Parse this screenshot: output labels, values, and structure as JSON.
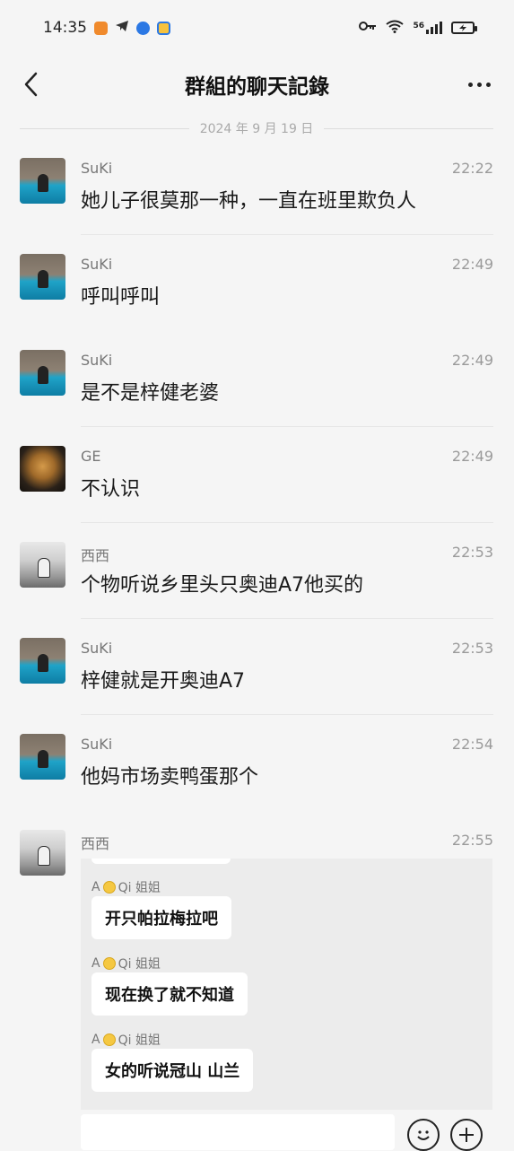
{
  "status_bar": {
    "time": "14:35",
    "network_label": "56",
    "battery_label": "",
    "icons": [
      "key-icon",
      "wifi-icon",
      "signal-icon",
      "battery-icon"
    ]
  },
  "nav": {
    "title": "群組的聊天記錄",
    "back_icon": "chevron-left-icon",
    "more_icon": "more-dots-icon"
  },
  "date_separator": "2024 年 9 月 19 日",
  "messages": [
    {
      "sender": "SuKi",
      "time": "22:22",
      "text": "她儿子很莫那一种，一直在班里欺负人",
      "avatar": "suki"
    },
    {
      "sender": "SuKi",
      "time": "22:49",
      "text": "呼叫呼叫",
      "avatar": "suki"
    },
    {
      "sender": "SuKi",
      "time": "22:49",
      "text": "是不是梓健老婆",
      "avatar": "suki"
    },
    {
      "sender": "GE",
      "time": "22:49",
      "text": "不认识",
      "avatar": "ge"
    },
    {
      "sender": "西西",
      "time": "22:53",
      "text": "个物听说乡里头只奥迪A7他买的",
      "avatar": "xixi"
    },
    {
      "sender": "SuKi",
      "time": "22:53",
      "text": "梓健就是开奥迪A7",
      "avatar": "suki"
    },
    {
      "sender": "SuKi",
      "time": "22:54",
      "text": "他妈市场卖鸭蛋那个",
      "avatar": "suki"
    },
    {
      "sender": "西西",
      "time": "22:55",
      "text": "",
      "avatar": "xixi"
    }
  ],
  "quoted": {
    "items": [
      {
        "sender_prefix": "A",
        "sender_name": "Qi 姐姐",
        "text": "开只帕拉梅拉吧"
      },
      {
        "sender_prefix": "A",
        "sender_name": "Qi 姐姐",
        "text": "现在换了就不知道"
      },
      {
        "sender_prefix": "A",
        "sender_name": "Qi 姐姐",
        "text": "女的听说冠山 山兰"
      }
    ]
  },
  "input_bar": {
    "emoji_icon": "emoji-icon",
    "plus_icon": "plus-icon"
  }
}
